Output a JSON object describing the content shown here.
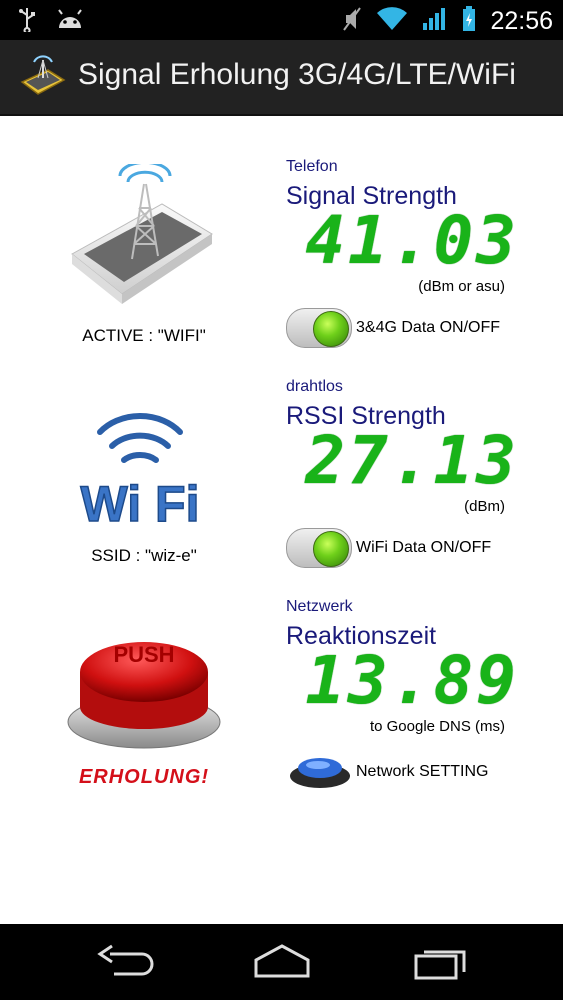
{
  "status_bar": {
    "time": "22:56",
    "icons": [
      "usb-icon",
      "android-icon",
      "mute-icon",
      "wifi-icon",
      "signal-icon",
      "battery-icon"
    ]
  },
  "action_bar": {
    "title": "Signal Erholung 3G/4G/LTE/WiFi"
  },
  "phone": {
    "caption": "ACTIVE : \"WIFI\"",
    "category": "Telefon",
    "heading": "Signal Strength",
    "value": "41.03",
    "unit": "(dBm or asu)",
    "toggle_label": "3&4G Data ON/OFF",
    "toggle_on": true
  },
  "wifi": {
    "caption": "SSID : \"wiz-e\"",
    "logo_text": "Wi Fi",
    "category": "drahtlos",
    "heading": "RSSI Strength",
    "value": "27.13",
    "unit": "(dBm)",
    "toggle_label": "WiFi Data ON/OFF",
    "toggle_on": true
  },
  "network": {
    "push_label": "PUSH",
    "caption": "ERHOLUNG!",
    "category": "Netzwerk",
    "heading": "Reaktionszeit",
    "value": "13.89",
    "unit": "to Google DNS (ms)",
    "button_label": "Network SETTING"
  },
  "colors": {
    "heading": "#1a1a7a",
    "lcd_green": "#19b319",
    "caption_red": "#d4101a"
  },
  "nav_bar": {
    "icons": [
      "back-icon",
      "home-icon",
      "recents-icon"
    ]
  }
}
